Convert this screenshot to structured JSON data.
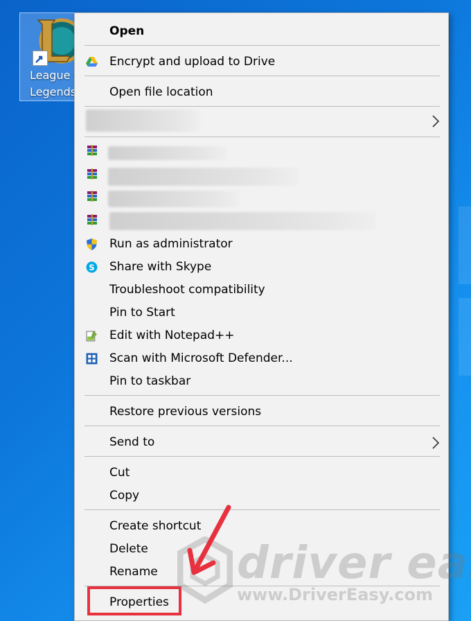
{
  "desktop": {
    "shortcut_label_line1": "League of",
    "shortcut_label_line2": "Legends"
  },
  "menu": {
    "open": "Open",
    "encrypt_upload": "Encrypt and upload to Drive",
    "open_file_location": "Open file location",
    "run_as_admin": "Run as administrator",
    "share_skype": "Share with Skype",
    "troubleshoot": "Troubleshoot compatibility",
    "pin_start": "Pin to Start",
    "edit_notepad": "Edit with Notepad++",
    "scan_defender": "Scan with Microsoft Defender...",
    "pin_taskbar": "Pin to taskbar",
    "restore_versions": "Restore previous versions",
    "send_to": "Send to",
    "cut": "Cut",
    "copy": "Copy",
    "create_shortcut": "Create shortcut",
    "delete": "Delete",
    "rename": "Rename",
    "properties": "Properties"
  },
  "watermark": {
    "brand": "driver easy",
    "url": "www.DriverEasy.com"
  },
  "colors": {
    "desktop_blue": "#0d77dc",
    "menu_bg": "#f2f2f2",
    "highlight_red": "#e8313f"
  }
}
